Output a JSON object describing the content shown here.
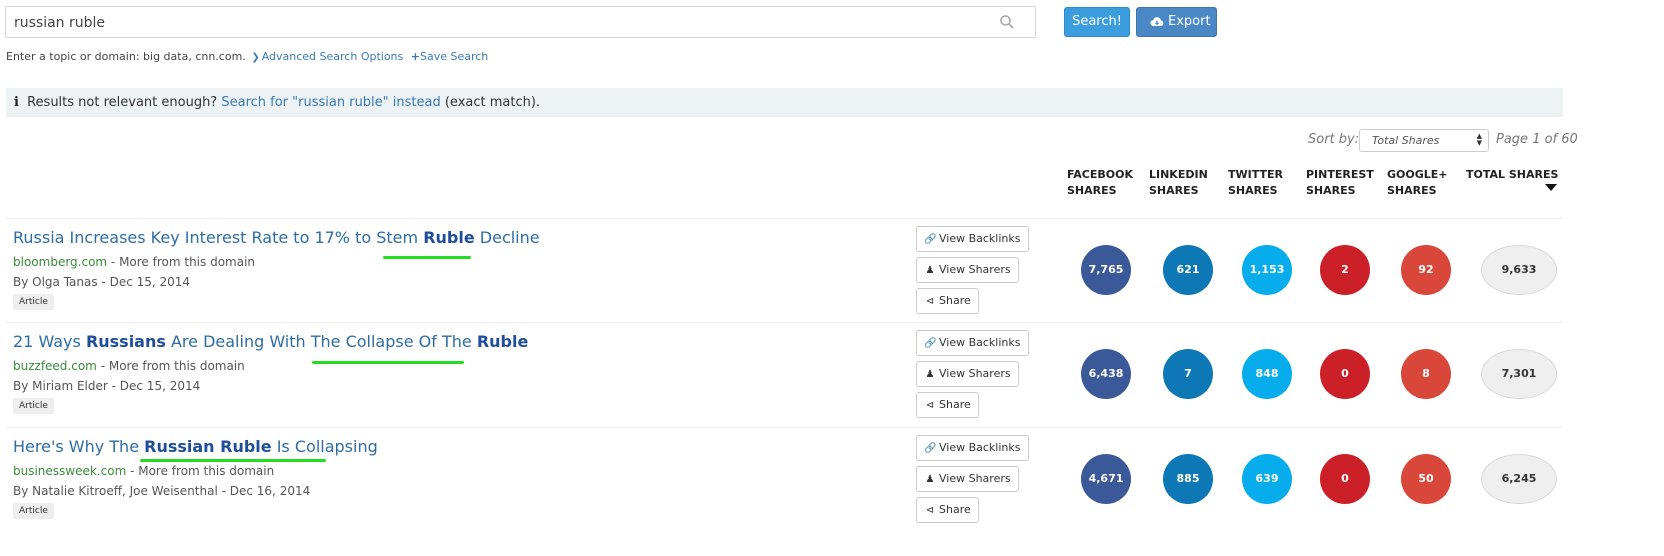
{
  "search": {
    "value": "russian ruble",
    "search_label": "Search!",
    "export_label": "Export",
    "hint_text": "Enter a topic or domain: big data, cnn.com.",
    "advanced_label": "Advanced Search Options",
    "save_label": "Save Search"
  },
  "alert": {
    "prefix": "Results not relevant enough?",
    "link": "Search for \"russian ruble\" instead",
    "suffix": "(exact match)."
  },
  "sort": {
    "label": "Sort by:",
    "selected": "Total Shares",
    "page_info": "Page 1 of 60"
  },
  "columns": [
    {
      "line1": "FACEBOOK",
      "line2": "SHARES"
    },
    {
      "line1": "LINKEDIN",
      "line2": "SHARES"
    },
    {
      "line1": "TWITTER",
      "line2": "SHARES"
    },
    {
      "line1": "PINTEREST",
      "line2": "SHARES"
    },
    {
      "line1": "GOOGLE+",
      "line2": "SHARES"
    },
    {
      "line1": "TOTAL SHARES",
      "line2": ""
    }
  ],
  "actions": {
    "backlinks": "View Backlinks",
    "sharers": "View Sharers",
    "share": "Share"
  },
  "colors": {
    "facebook": "#3b5998",
    "linkedin": "#0e77b5",
    "twitter": "#07aced",
    "pinterest": "#cb2028",
    "googleplus": "#d9473a",
    "highlight": "#22dd22"
  },
  "results": [
    {
      "title_parts": [
        {
          "text": "Russia Increases Key Interest Rate to 17% to Stem ",
          "bold": false
        },
        {
          "text": "Ruble",
          "bold": true
        },
        {
          "text": " Decline",
          "bold": false
        }
      ],
      "domain": "bloomberg.com",
      "more": " - More from this domain",
      "byline": "By Olga Tanas - Dec 15, 2014",
      "type": "Article",
      "facebook": "7,765",
      "linkedin": "621",
      "twitter": "1,153",
      "pinterest": "2",
      "googleplus": "92",
      "total": "9,633"
    },
    {
      "title_parts": [
        {
          "text": "21 Ways ",
          "bold": false
        },
        {
          "text": "Russians",
          "bold": true
        },
        {
          "text": " Are Dealing With The Collapse Of The ",
          "bold": false
        },
        {
          "text": "Ruble",
          "bold": true
        }
      ],
      "domain": "buzzfeed.com",
      "more": " - More from this domain",
      "byline": "By Miriam Elder - Dec 15, 2014",
      "type": "Article",
      "facebook": "6,438",
      "linkedin": "7",
      "twitter": "848",
      "pinterest": "0",
      "googleplus": "8",
      "total": "7,301"
    },
    {
      "title_parts": [
        {
          "text": "Here's Why The ",
          "bold": false
        },
        {
          "text": "Russian Ruble",
          "bold": true
        },
        {
          "text": " Is Collapsing",
          "bold": false
        }
      ],
      "domain": "businessweek.com",
      "more": " - More from this domain",
      "byline": "By Natalie Kitroeff, Joe Weisenthal - Dec 16, 2014",
      "type": "Article",
      "facebook": "4,671",
      "linkedin": "885",
      "twitter": "639",
      "pinterest": "0",
      "googleplus": "50",
      "total": "6,245"
    }
  ]
}
